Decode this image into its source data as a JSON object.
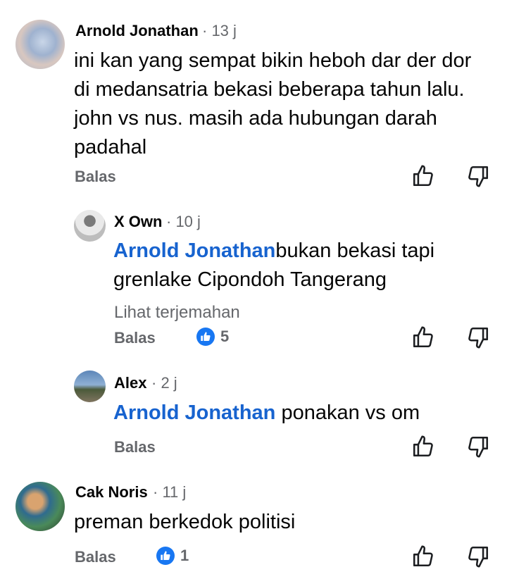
{
  "comments": [
    {
      "name": "Arnold Jonathan",
      "time": "· 13 j",
      "lines": [
        "ini kan yang sempat bikin heboh dar der dor",
        "di medansatria bekasi beberapa tahun lalu.",
        "john vs nus. masih ada hubungan darah",
        "padahal"
      ],
      "reply_label": "Balas"
    },
    {
      "name": "X Own",
      "time": "· 10 j",
      "mention": "Arnold Jonathan",
      "line1_rest": "bukan bekasi  tapi",
      "line2": "grenlake Cipondoh Tangerang",
      "translate_label": "Lihat terjemahan",
      "reply_label": "Balas",
      "like_count": "5"
    },
    {
      "name": "Alex",
      "time": "· 2 j",
      "mention": "Arnold Jonathan",
      "rest": " ponakan vs om",
      "reply_label": "Balas"
    },
    {
      "name": "Cak Noris",
      "time": "· 11 j",
      "text": "preman berkedok politisi",
      "reply_label": "Balas",
      "like_count": "1"
    }
  ],
  "icons": {
    "like": "thumbs-up-icon",
    "dislike": "thumbs-down-icon"
  },
  "colors": {
    "mention": "#1763cf",
    "like_badge": "#1877f2",
    "muted": "#65676b"
  }
}
